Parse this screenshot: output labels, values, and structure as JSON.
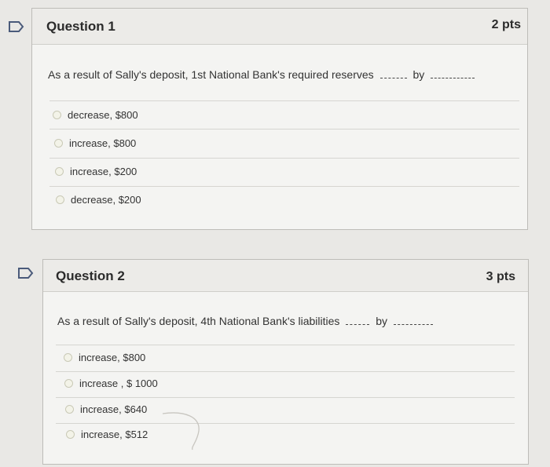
{
  "questions": [
    {
      "title": "Question 1",
      "points": "2 pts",
      "text_before": "As a result of Sally's deposit, 1st National Bank's required reserves",
      "text_mid": "by",
      "answers": [
        "decrease, $800",
        "increase, $800",
        "increase, $200",
        "decrease, $200"
      ]
    },
    {
      "title": "Question 2",
      "points": "3 pts",
      "text_before": "As a result of Sally's deposit, 4th National Bank's liabilities",
      "text_mid": "by",
      "answers": [
        "increase, $800",
        "increase , $ 1000",
        "increase, $640",
        "increase, $512"
      ]
    }
  ],
  "colors": {
    "flag": "#4a5a7a",
    "radio_border": "#c9c9b6"
  },
  "icons": {
    "flag": "flag-icon"
  }
}
